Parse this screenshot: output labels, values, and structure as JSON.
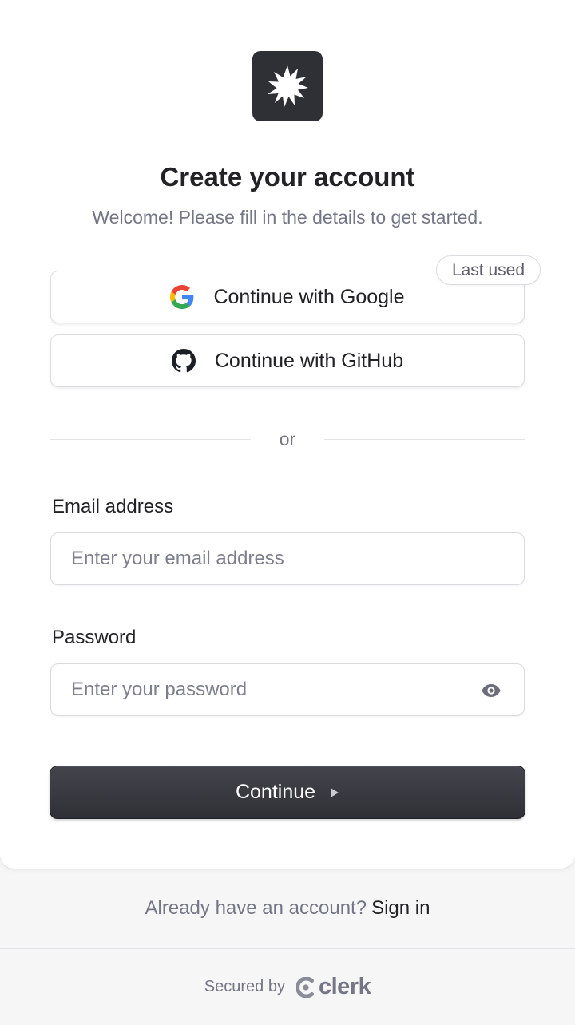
{
  "header": {
    "title": "Create your account",
    "subtitle": "Welcome! Please fill in the details to get started."
  },
  "social": {
    "google_label": "Continue with Google",
    "github_label": "Continue with GitHub",
    "last_used_badge": "Last used"
  },
  "divider": {
    "text": "or"
  },
  "form": {
    "email_label": "Email address",
    "email_placeholder": "Enter your email address",
    "email_value": "",
    "password_label": "Password",
    "password_placeholder": "Enter your password",
    "password_value": "",
    "submit_label": "Continue"
  },
  "footer": {
    "prompt": "Already have an account?",
    "signin_link": "Sign in",
    "secured_by": "Secured by",
    "brand": "clerk"
  },
  "icons": {
    "logo": "starburst-logo-icon",
    "google": "google-icon",
    "github": "github-icon",
    "eye": "eye-icon",
    "arrow": "play-arrow-icon",
    "clerk": "clerk-logo-icon"
  },
  "colors": {
    "primary": "#2f3036",
    "muted_text": "#747686",
    "text": "#212126",
    "footer_bg": "#f6f6f7"
  }
}
